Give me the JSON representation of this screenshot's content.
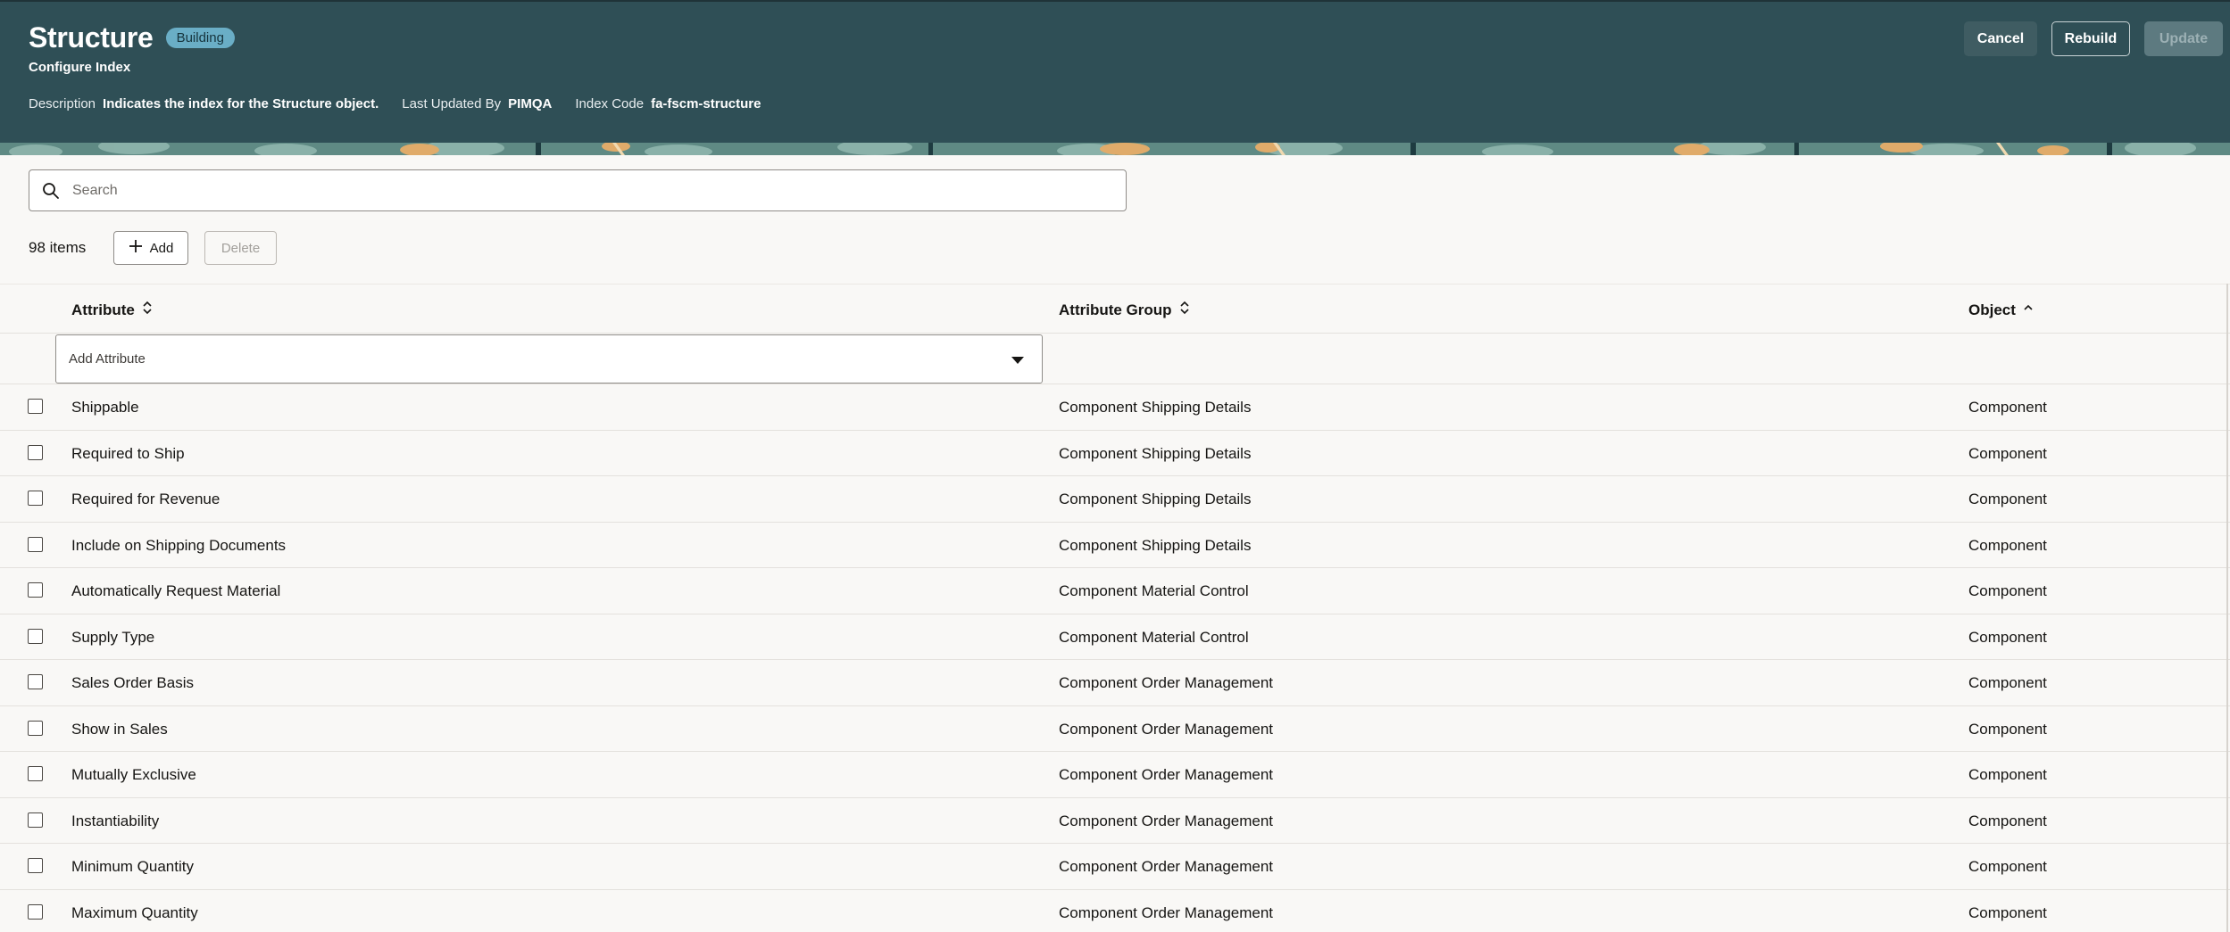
{
  "header": {
    "title": "Structure",
    "status_badge": "Building",
    "subtitle": "Configure Index",
    "meta": [
      {
        "label": "Description",
        "value": "Indicates the index for the Structure object."
      },
      {
        "label": "Last Updated By",
        "value": "PIMQA"
      },
      {
        "label": "Index Code",
        "value": "fa-fscm-structure"
      }
    ],
    "buttons": {
      "cancel": "Cancel",
      "rebuild": "Rebuild",
      "update": "Update"
    }
  },
  "search": {
    "placeholder": "Search"
  },
  "toolbar": {
    "count": "98 items",
    "add_label": "Add",
    "delete_label": "Delete"
  },
  "table": {
    "columns": {
      "attribute": "Attribute",
      "group": "Attribute Group",
      "object": "Object"
    },
    "add_attribute_placeholder": "Add Attribute",
    "rows": [
      {
        "attribute": "Shippable",
        "group": "Component Shipping Details",
        "object": "Component"
      },
      {
        "attribute": "Required to Ship",
        "group": "Component Shipping Details",
        "object": "Component"
      },
      {
        "attribute": "Required for Revenue",
        "group": "Component Shipping Details",
        "object": "Component"
      },
      {
        "attribute": "Include on Shipping Documents",
        "group": "Component Shipping Details",
        "object": "Component"
      },
      {
        "attribute": "Automatically Request Material",
        "group": "Component Material Control",
        "object": "Component"
      },
      {
        "attribute": "Supply Type",
        "group": "Component Material Control",
        "object": "Component"
      },
      {
        "attribute": "Sales Order Basis",
        "group": "Component Order Management",
        "object": "Component"
      },
      {
        "attribute": "Show in Sales",
        "group": "Component Order Management",
        "object": "Component"
      },
      {
        "attribute": "Mutually Exclusive",
        "group": "Component Order Management",
        "object": "Component"
      },
      {
        "attribute": "Instantiability",
        "group": "Component Order Management",
        "object": "Component"
      },
      {
        "attribute": "Minimum Quantity",
        "group": "Component Order Management",
        "object": "Component"
      },
      {
        "attribute": "Maximum Quantity",
        "group": "Component Order Management",
        "object": "Component"
      }
    ]
  },
  "colors": {
    "header_bg": "#2f4f56",
    "badge_bg": "#6aaec6",
    "page_bg": "#f9f8f6"
  }
}
